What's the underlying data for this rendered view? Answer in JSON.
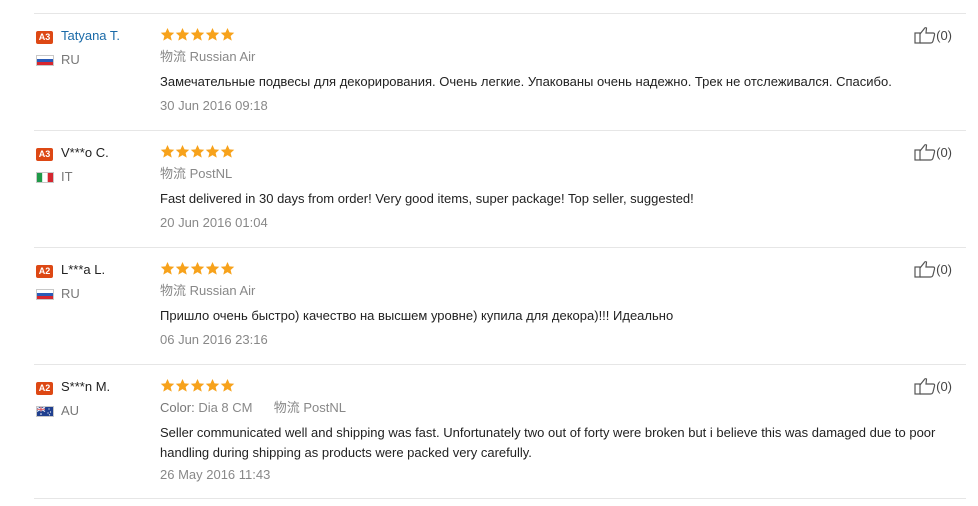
{
  "colors": {
    "accent": "#dd4814",
    "star": "#f7a21b",
    "link": "#1a6aa8"
  },
  "reviews": [
    {
      "badge": "A3",
      "name": "Tatyana T.",
      "flag": "flag-ru",
      "country": "RU",
      "rating": 5,
      "color_label": "",
      "color_value": "",
      "ship_icon": "物流",
      "shipping": "Russian Air",
      "text": "Замечательные подвесы для декорирования. Очень легкие. Упакованы очень надежно. Трек не отслеживался. Спасибо.",
      "date": "30 Jun 2016 09:18",
      "likes": "(0)"
    },
    {
      "badge": "A3",
      "name": "V***o C.",
      "flag": "flag-it",
      "country": "IT",
      "rating": 5,
      "color_label": "",
      "color_value": "",
      "ship_icon": "物流",
      "shipping": "PostNL",
      "text": "Fast delivered in 30 days from order! Very good items, super package! Top seller, suggested!",
      "date": "20 Jun 2016 01:04",
      "likes": "(0)"
    },
    {
      "badge": "A2",
      "name": "L***a L.",
      "flag": "flag-ru",
      "country": "RU",
      "rating": 5,
      "color_label": "",
      "color_value": "",
      "ship_icon": "物流",
      "shipping": "Russian Air",
      "text": "Пришло очень быстро) качество на высшем уровне) купила для декора)!!! Идеально",
      "date": "06 Jun 2016 23:16",
      "likes": "(0)"
    },
    {
      "badge": "A2",
      "name": "S***n M.",
      "flag": "flag-au",
      "country": "AU",
      "rating": 5,
      "color_label": "Color:",
      "color_value": "Dia 8 CM",
      "ship_icon": "物流",
      "shipping": "PostNL",
      "text": "Seller communicated well and shipping was fast. Unfortunately two out of forty were broken but i believe this was damaged due to poor handling during shipping as products were packed very carefully.",
      "date": "26 May 2016 11:43",
      "likes": "(0)"
    }
  ]
}
